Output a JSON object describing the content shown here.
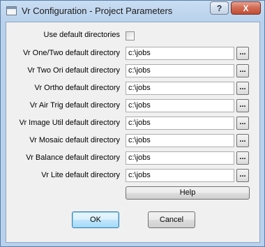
{
  "window": {
    "title": "Vr Configuration - Project Parameters",
    "help_glyph": "?",
    "close_glyph": "X"
  },
  "form": {
    "use_default_label": "Use default directories",
    "use_default_checked": false,
    "browse_label": "...",
    "rows": [
      {
        "label": "Vr One/Two default directory",
        "value": "c:\\jobs"
      },
      {
        "label": "Vr Two Ori default directory",
        "value": "c:\\jobs"
      },
      {
        "label": "Vr Ortho default directory",
        "value": "c:\\jobs"
      },
      {
        "label": "Vr Air Trig default directory",
        "value": "c:\\jobs"
      },
      {
        "label": "Vr Image Util default directory",
        "value": "c:\\jobs"
      },
      {
        "label": "Vr Mosaic default directory",
        "value": "c:\\jobs"
      },
      {
        "label": "Vr Balance default directory",
        "value": "c:\\jobs"
      },
      {
        "label": "Vr Lite default directory",
        "value": "c:\\jobs"
      }
    ]
  },
  "buttons": {
    "help": "Help",
    "ok": "OK",
    "cancel": "Cancel"
  }
}
